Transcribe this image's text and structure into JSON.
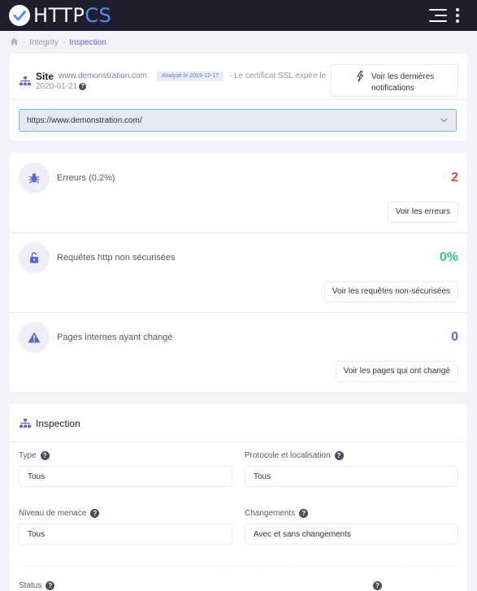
{
  "brand": {
    "part1": "HTTP",
    "part2": "CS",
    "accent": "#4f8ff7"
  },
  "breadcrumb": {
    "home_icon": "home-icon",
    "items": [
      "Integrity",
      "Inspection"
    ]
  },
  "site": {
    "title": "Site",
    "url": "www.demonstration.com",
    "badge": "Analysé le 2019-12-17",
    "ssl_text": "- Le certificat SSL expire le",
    "ssl_date": "2020-01-21",
    "notifications_label": "Voir les dernières notifications",
    "selected_url": "https://www.demonstration.com/"
  },
  "stats": [
    {
      "label": "Erreurs (0.2%)",
      "value": "2",
      "color": "#d9534f",
      "button": "Voir les erreurs",
      "icon": "bug-icon"
    },
    {
      "label": "Requêtes http non sécurisées",
      "value": "0%",
      "color": "#34bfa3",
      "button": "Voir les requêtes non-sécurisées",
      "icon": "unlock-icon"
    },
    {
      "label": "Pages internes ayant changé",
      "value": "0",
      "color": "#5867dd",
      "button": "Voir les pages qui ont changé",
      "icon": "warning-icon"
    }
  ],
  "inspection": {
    "title": "Inspection",
    "fields": {
      "type": {
        "label": "Type",
        "value": "Tous"
      },
      "protocol": {
        "label": "Protocole et localisation",
        "value": "Tous"
      },
      "threat": {
        "label": "Niveau de menace",
        "value": "Tous"
      },
      "changes": {
        "label": "Changements",
        "value": "Avec et sans changements"
      },
      "status": {
        "label": "Status"
      }
    }
  }
}
